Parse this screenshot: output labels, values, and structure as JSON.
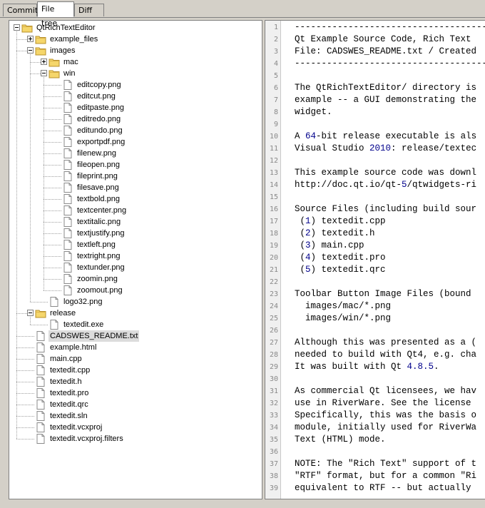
{
  "tabs": [
    {
      "label": "Commit",
      "active": false
    },
    {
      "label": "File tree",
      "active": true
    },
    {
      "label": "Diff",
      "active": false
    }
  ],
  "tree": {
    "rows": [
      {
        "label": "QtRichTextEditor",
        "type": "folder",
        "depth": 0,
        "expander": "minus",
        "name": "tree-folder-qtrichtexteditor"
      },
      {
        "label": "example_files",
        "type": "folder",
        "depth": 1,
        "expander": "plus",
        "name": "tree-folder-example-files"
      },
      {
        "label": "images",
        "type": "folder",
        "depth": 1,
        "expander": "minus",
        "name": "tree-folder-images"
      },
      {
        "label": "mac",
        "type": "folder",
        "depth": 2,
        "expander": "plus",
        "name": "tree-folder-mac"
      },
      {
        "label": "win",
        "type": "folder",
        "depth": 2,
        "expander": "minus",
        "name": "tree-folder-win"
      },
      {
        "label": "editcopy.png",
        "type": "file",
        "depth": 3
      },
      {
        "label": "editcut.png",
        "type": "file",
        "depth": 3
      },
      {
        "label": "editpaste.png",
        "type": "file",
        "depth": 3
      },
      {
        "label": "editredo.png",
        "type": "file",
        "depth": 3
      },
      {
        "label": "editundo.png",
        "type": "file",
        "depth": 3
      },
      {
        "label": "exportpdf.png",
        "type": "file",
        "depth": 3
      },
      {
        "label": "filenew.png",
        "type": "file",
        "depth": 3
      },
      {
        "label": "fileopen.png",
        "type": "file",
        "depth": 3
      },
      {
        "label": "fileprint.png",
        "type": "file",
        "depth": 3
      },
      {
        "label": "filesave.png",
        "type": "file",
        "depth": 3
      },
      {
        "label": "textbold.png",
        "type": "file",
        "depth": 3
      },
      {
        "label": "textcenter.png",
        "type": "file",
        "depth": 3
      },
      {
        "label": "textitalic.png",
        "type": "file",
        "depth": 3
      },
      {
        "label": "textjustify.png",
        "type": "file",
        "depth": 3
      },
      {
        "label": "textleft.png",
        "type": "file",
        "depth": 3
      },
      {
        "label": "textright.png",
        "type": "file",
        "depth": 3
      },
      {
        "label": "textunder.png",
        "type": "file",
        "depth": 3
      },
      {
        "label": "zoomin.png",
        "type": "file",
        "depth": 3
      },
      {
        "label": "zoomout.png",
        "type": "file",
        "depth": 3
      },
      {
        "label": "logo32.png",
        "type": "file",
        "depth": 2
      },
      {
        "label": "release",
        "type": "folder",
        "depth": 1,
        "expander": "minus",
        "name": "tree-folder-release"
      },
      {
        "label": "textedit.exe",
        "type": "file",
        "depth": 2
      },
      {
        "label": "CADSWES_README.txt",
        "type": "file",
        "depth": 1,
        "selected": true
      },
      {
        "label": "example.html",
        "type": "file",
        "depth": 1
      },
      {
        "label": "main.cpp",
        "type": "file",
        "depth": 1
      },
      {
        "label": "textedit.cpp",
        "type": "file",
        "depth": 1
      },
      {
        "label": "textedit.h",
        "type": "file",
        "depth": 1
      },
      {
        "label": "textedit.pro",
        "type": "file",
        "depth": 1
      },
      {
        "label": "textedit.qrc",
        "type": "file",
        "depth": 1
      },
      {
        "label": "textedit.sln",
        "type": "file",
        "depth": 1
      },
      {
        "label": "textedit.vcxproj",
        "type": "file",
        "depth": 1
      },
      {
        "label": "textedit.vcxproj.filters",
        "type": "file",
        "depth": 1
      }
    ]
  },
  "editor": {
    "lines": [
      {
        "n": "1",
        "text": "----------------------------------------"
      },
      {
        "n": "2",
        "text": "Qt Example Source Code, Rich Text"
      },
      {
        "n": "3",
        "text": "File: CADSWES_README.txt / Created"
      },
      {
        "n": "4",
        "text": "----------------------------------------"
      },
      {
        "n": "5",
        "text": ""
      },
      {
        "n": "6",
        "text": "The QtRichTextEditor/ directory is"
      },
      {
        "n": "7",
        "text": "example -- a GUI demonstrating the"
      },
      {
        "n": "8",
        "text": "widget."
      },
      {
        "n": "9",
        "text": ""
      },
      {
        "n": "10",
        "text": "A 64-bit release executable is als"
      },
      {
        "n": "11",
        "text": "Visual Studio 2010: release/textec"
      },
      {
        "n": "12",
        "text": ""
      },
      {
        "n": "13",
        "text": "This example source code was downl"
      },
      {
        "n": "14",
        "text": "http://doc.qt.io/qt-5/qtwidgets-ri"
      },
      {
        "n": "15",
        "text": ""
      },
      {
        "n": "16",
        "text": "Source Files (including build sour"
      },
      {
        "n": "17",
        "text": " (1) textedit.cpp"
      },
      {
        "n": "18",
        "text": " (2) textedit.h"
      },
      {
        "n": "19",
        "text": " (3) main.cpp"
      },
      {
        "n": "20",
        "text": " (4) textedit.pro"
      },
      {
        "n": "21",
        "text": " (5) textedit.qrc"
      },
      {
        "n": "22",
        "text": ""
      },
      {
        "n": "23",
        "text": "Toolbar Button Image Files (bound"
      },
      {
        "n": "24",
        "text": "  images/mac/*.png"
      },
      {
        "n": "25",
        "text": "  images/win/*.png"
      },
      {
        "n": "26",
        "text": ""
      },
      {
        "n": "27",
        "text": "Although this was presented as a ("
      },
      {
        "n": "28",
        "text": "needed to build with Qt4, e.g. cha"
      },
      {
        "n": "29",
        "text": "It was built with Qt 4.8.5."
      },
      {
        "n": "30",
        "text": ""
      },
      {
        "n": "31",
        "text": "As commercial Qt licensees, we hav"
      },
      {
        "n": "32",
        "text": "use in RiverWare. See the license"
      },
      {
        "n": "33",
        "text": "Specifically, this was the basis o"
      },
      {
        "n": "34",
        "text": "module, initially used for RiverWa"
      },
      {
        "n": "35",
        "text": "Text (HTML) mode."
      },
      {
        "n": "36",
        "text": ""
      },
      {
        "n": "37",
        "text": "NOTE: The \"Rich Text\" support of t"
      },
      {
        "n": "38",
        "text": "\"RTF\" format, but for a common \"Ri"
      },
      {
        "n": "39",
        "text": "equivalent to RTF -- but actually"
      }
    ]
  },
  "colors": {
    "number": "#00008b",
    "folder": "#f0c040",
    "selected": "#dcdcdc"
  }
}
